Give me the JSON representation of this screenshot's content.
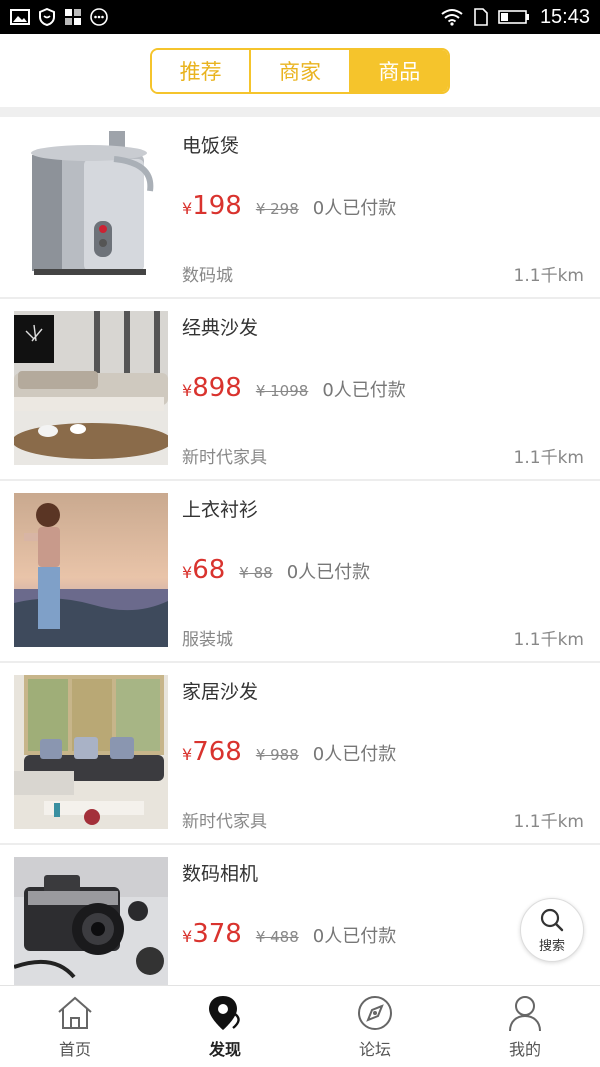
{
  "status_bar": {
    "time": "15:43"
  },
  "segments": [
    {
      "label": "推荐",
      "active": false
    },
    {
      "label": "商家",
      "active": false
    },
    {
      "label": "商品",
      "active": true
    }
  ],
  "products": [
    {
      "name": "电饭煲",
      "currency": "¥",
      "price": "198",
      "original": "¥ 298",
      "paid": "0人已付款",
      "shop": "数码城",
      "distance": "1.1千km",
      "image": "juicer"
    },
    {
      "name": "经典沙发",
      "currency": "¥",
      "price": "898",
      "original": "¥ 1098",
      "paid": "0人已付款",
      "shop": "新时代家具",
      "distance": "1.1千km",
      "image": "sofa-room"
    },
    {
      "name": "上衣衬衫",
      "currency": "¥",
      "price": "68",
      "original": "¥ 88",
      "paid": "0人已付款",
      "shop": "服装城",
      "distance": "1.1千km",
      "image": "woman-field"
    },
    {
      "name": "家居沙发",
      "currency": "¥",
      "price": "768",
      "original": "¥ 988",
      "paid": "0人已付款",
      "shop": "新时代家具",
      "distance": "1.1千km",
      "image": "sofa-window"
    },
    {
      "name": "数码相机",
      "currency": "¥",
      "price": "378",
      "original": "¥ 488",
      "paid": "0人已付款",
      "shop": "",
      "distance": "",
      "image": "camera"
    }
  ],
  "float_search": {
    "label": "搜索",
    "icon": "search-icon"
  },
  "tabbar": [
    {
      "label": "首页",
      "icon": "home-icon",
      "active": false
    },
    {
      "label": "发现",
      "icon": "location-pin-icon",
      "active": true
    },
    {
      "label": "论坛",
      "icon": "compass-icon",
      "active": false
    },
    {
      "label": "我的",
      "icon": "user-icon",
      "active": false
    }
  ],
  "colors": {
    "accent": "#f5c42c",
    "price": "#d9332e"
  }
}
